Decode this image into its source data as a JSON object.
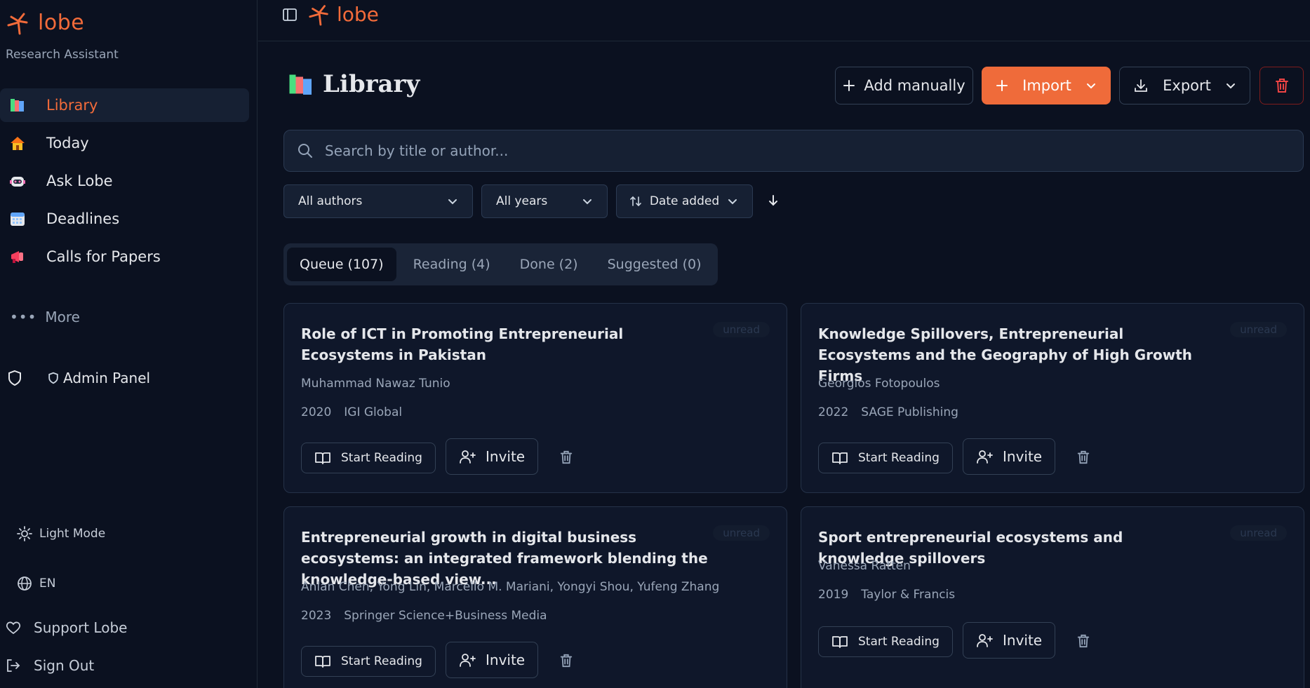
{
  "brand": {
    "name": "lobe",
    "subtitle": "Research Assistant"
  },
  "sidebar": {
    "items": [
      {
        "label": "Library",
        "icon": "books-icon"
      },
      {
        "label": "Today",
        "icon": "house-icon"
      },
      {
        "label": "Ask Lobe",
        "icon": "robot-icon"
      },
      {
        "label": "Deadlines",
        "icon": "calendar-icon"
      },
      {
        "label": "Calls for Papers",
        "icon": "megaphone-icon"
      }
    ],
    "more_label": "More",
    "admin_label": "Admin Panel",
    "light_mode_label": "Light Mode",
    "language_label": "EN",
    "support_label": "Support Lobe",
    "sign_out_label": "Sign Out"
  },
  "topbar": {
    "brand": "lobe"
  },
  "header": {
    "title": "Library",
    "add_manually_label": "Add manually",
    "import_label": "Import",
    "export_label": "Export"
  },
  "search": {
    "placeholder": "Search by title or author..."
  },
  "filters": {
    "authors": "All authors",
    "years": "All years",
    "sort": "Date added"
  },
  "tabs": [
    {
      "label": "Queue (107)"
    },
    {
      "label": "Reading (4)"
    },
    {
      "label": "Done (2)"
    },
    {
      "label": "Suggested (0)"
    }
  ],
  "cards": [
    {
      "title": "Role of ICT in Promoting Entrepreneurial Ecosystems in Pakistan",
      "status": "unread",
      "authors": "Muhammad Nawaz Tunio",
      "year": "2020",
      "publisher": "IGI Global",
      "start_label": "Start Reading",
      "invite_label": "Invite"
    },
    {
      "title": "Knowledge Spillovers, Entrepreneurial Ecosystems and the Geography of High Growth Firms",
      "status": "unread",
      "authors": "Georgios Fotopoulos",
      "year": "2022",
      "publisher": "SAGE Publishing",
      "start_label": "Start Reading",
      "invite_label": "Invite"
    },
    {
      "title": "Entrepreneurial growth in digital business ecosystems: an integrated framework blending the knowledge-based view...",
      "status": "unread",
      "authors": "Anlan Chen, Yong Lin, Marcello M. Mariani, Yongyi Shou, Yufeng Zhang",
      "year": "2023",
      "publisher": "Springer Science+Business Media",
      "start_label": "Start Reading",
      "invite_label": "Invite"
    },
    {
      "title": "Sport entrepreneurial ecosystems and knowledge spillovers",
      "status": "unread",
      "authors": "Vanessa Ratten",
      "year": "2019",
      "publisher": "Taylor & Francis",
      "start_label": "Start Reading",
      "invite_label": "Invite"
    }
  ],
  "colors": {
    "accent": "#ef6b3a",
    "background": "#0b1120",
    "panel": "#162033"
  }
}
